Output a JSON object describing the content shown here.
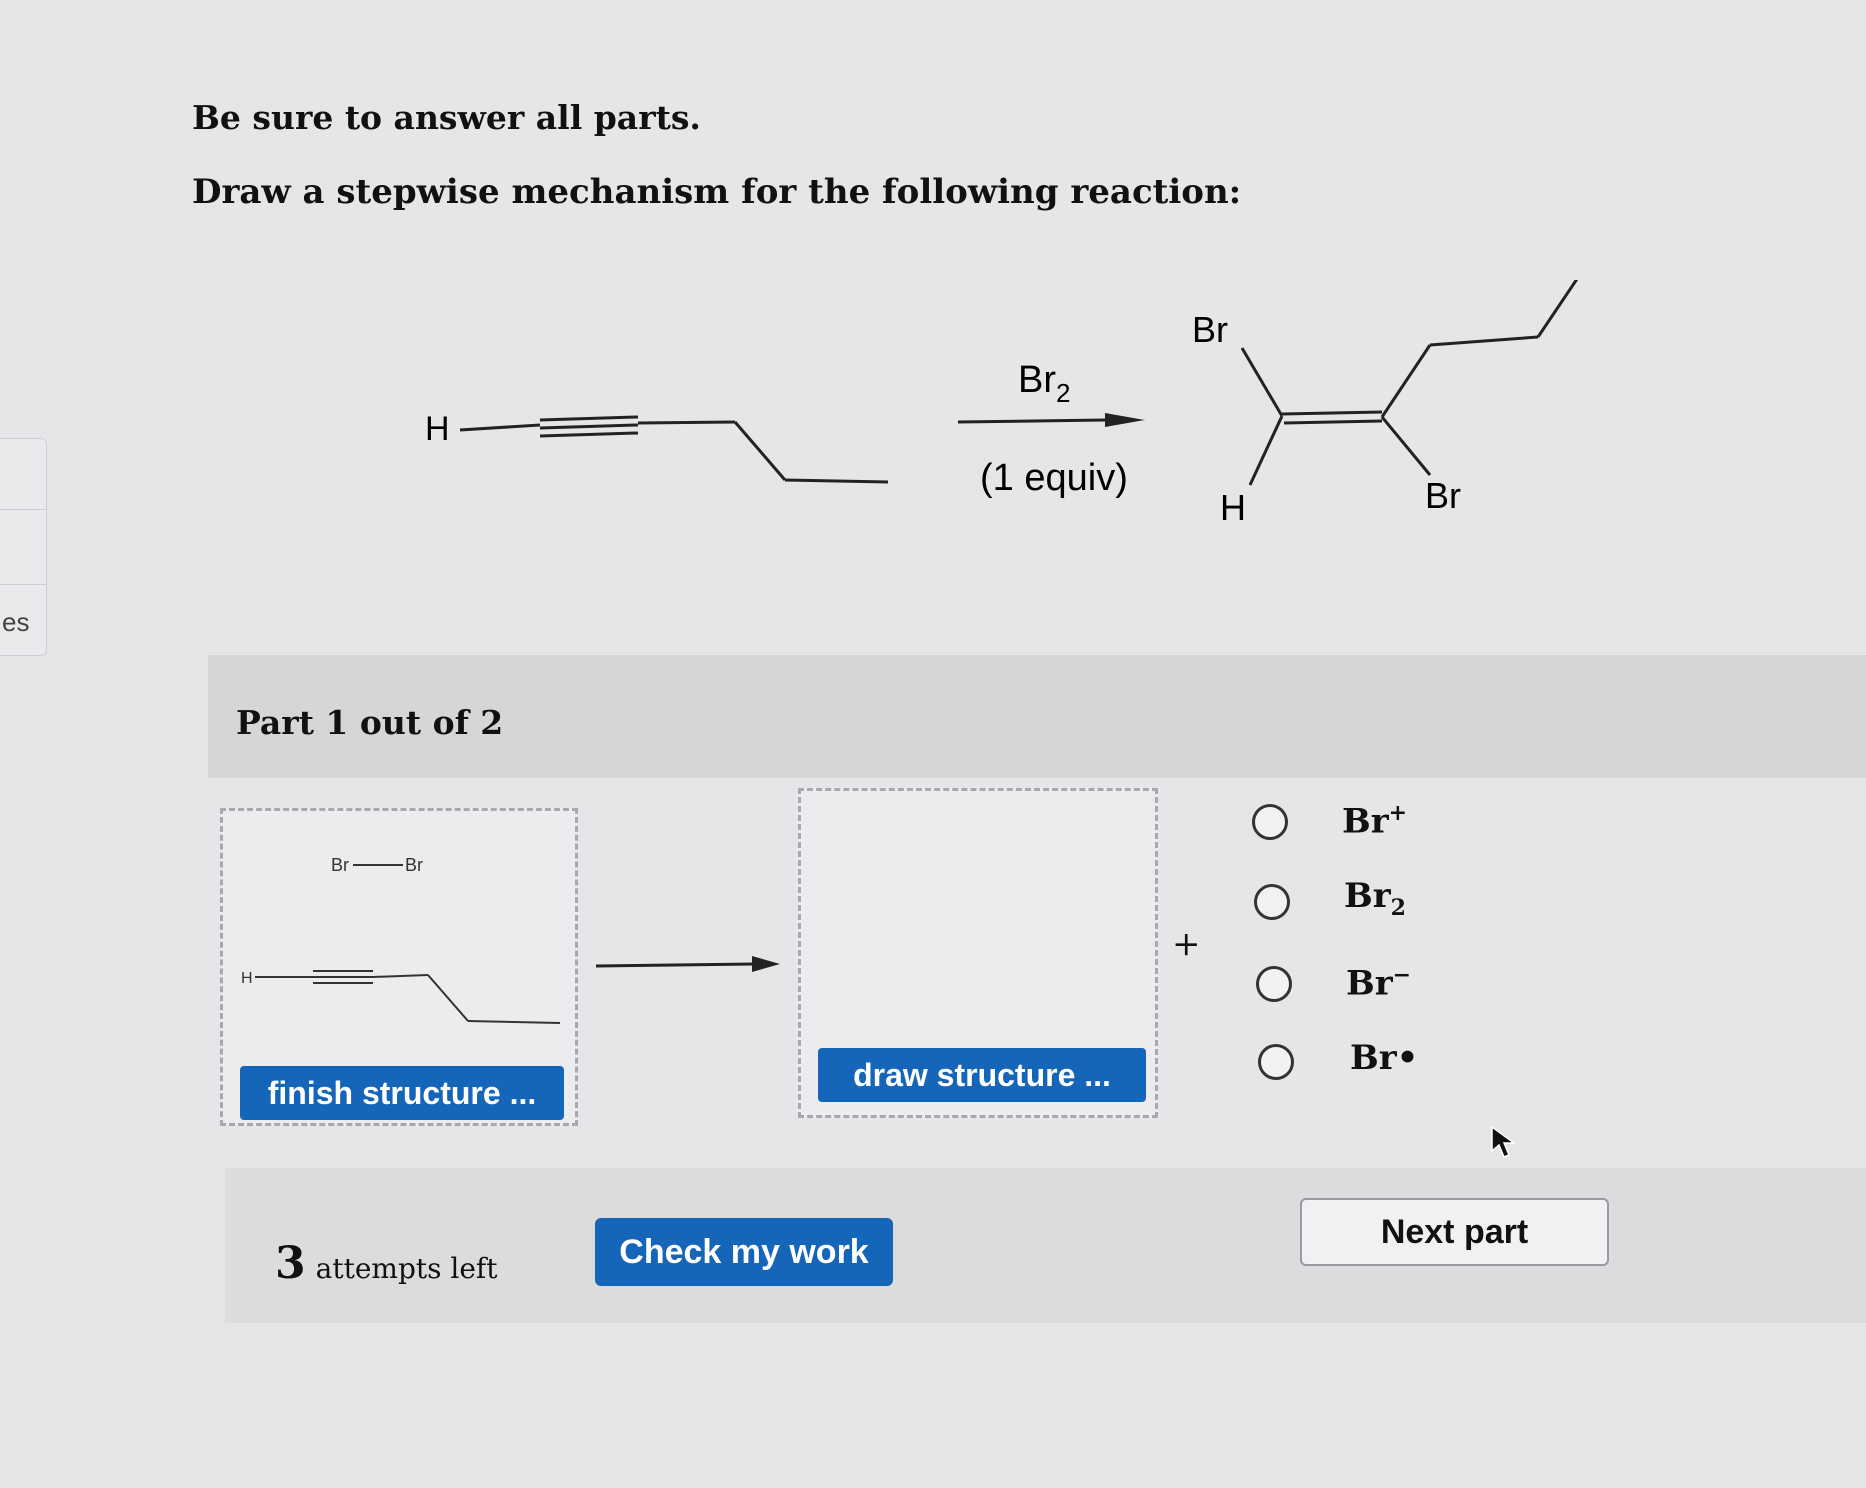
{
  "side_tab": {
    "label": "es"
  },
  "question": {
    "instruction": "Be sure to answer all parts.",
    "prompt": "Draw a stepwise mechanism for the following reaction:"
  },
  "reaction": {
    "reactant_h": "H",
    "reagent": "Br",
    "reagent_subscript": "2",
    "reagent_condition": "(1 equiv)",
    "product_br_top": "Br",
    "product_h": "H",
    "product_br_bottom": "Br"
  },
  "part": {
    "label": "Part 1 out of 2"
  },
  "workspace": {
    "box1": {
      "br_left": "Br",
      "br_right": "Br",
      "h_label": "H"
    },
    "finish_button": "finish structure ...",
    "draw_button": "draw structure ...",
    "plus": "+"
  },
  "options": [
    {
      "text": "Br",
      "sup": "+",
      "sub": ""
    },
    {
      "text": "Br",
      "sup": "",
      "sub": "2"
    },
    {
      "text": "Br",
      "sup": "−",
      "sub": ""
    },
    {
      "text": "Br•",
      "sup": "",
      "sub": ""
    }
  ],
  "footer": {
    "attempts_number": "3",
    "attempts_text": "attempts left",
    "check_button": "Check my work",
    "next_button": "Next part"
  },
  "colors": {
    "button_blue": "#1565b8",
    "background": "#e6e6e8"
  }
}
